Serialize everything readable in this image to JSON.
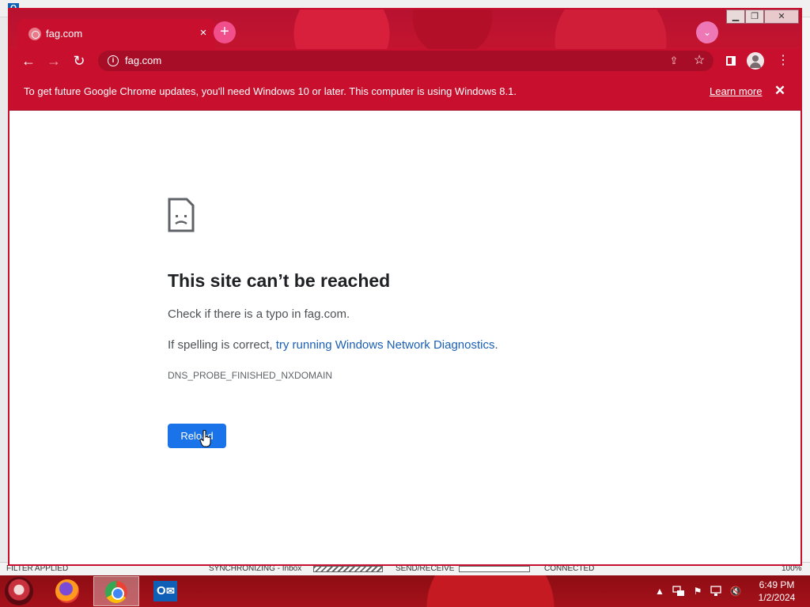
{
  "background_app": {
    "status": {
      "filter": "FILTER APPLIED",
      "sync": "SYNCHRONIZING - Inbox",
      "send": "SEND/RECEIVE",
      "connected": "CONNECTED",
      "zoom": "100%"
    }
  },
  "browser": {
    "tab": {
      "title": "fag.com",
      "close": "×"
    },
    "new_tab": "+",
    "tab_search": "⌄",
    "window_controls": {
      "minimize": "▁",
      "maximize": "❐",
      "close": "✕"
    },
    "toolbar": {
      "back": "←",
      "forward": "→",
      "reload": "↻",
      "menu": "⋮"
    },
    "omnibox": {
      "url": "fag.com",
      "info": "i",
      "share": "⇪",
      "star": "☆"
    },
    "infobar": {
      "message": "To get future Google Chrome updates, you'll need Windows 10 or later. This computer is using Windows 8.1.",
      "learn_more": "Learn more",
      "close": "✕"
    },
    "error_page": {
      "title": "This site can’t be reached",
      "line1": "Check if there is a typo in fag.com.",
      "line2_prefix": "If spelling is correct, ",
      "line2_link": "try running Windows Network Diagnostics",
      "line2_suffix": ".",
      "error_code": "DNS_PROBE_FINISHED_NXDOMAIN",
      "reload_button": "Reload"
    }
  },
  "taskbar": {
    "apps": [
      "firefox",
      "chrome",
      "outlook"
    ],
    "active_app": "chrome",
    "outlook_letter": "O",
    "tray": {
      "up_arrow": "▲",
      "flag": "⚑",
      "volume": "🔇"
    },
    "clock": {
      "time": "6:49 PM",
      "date": "1/2/2024"
    }
  },
  "colors": {
    "theme_red": "#c8102e",
    "link_blue": "#1a5fb4",
    "button_blue": "#1a73e8"
  }
}
